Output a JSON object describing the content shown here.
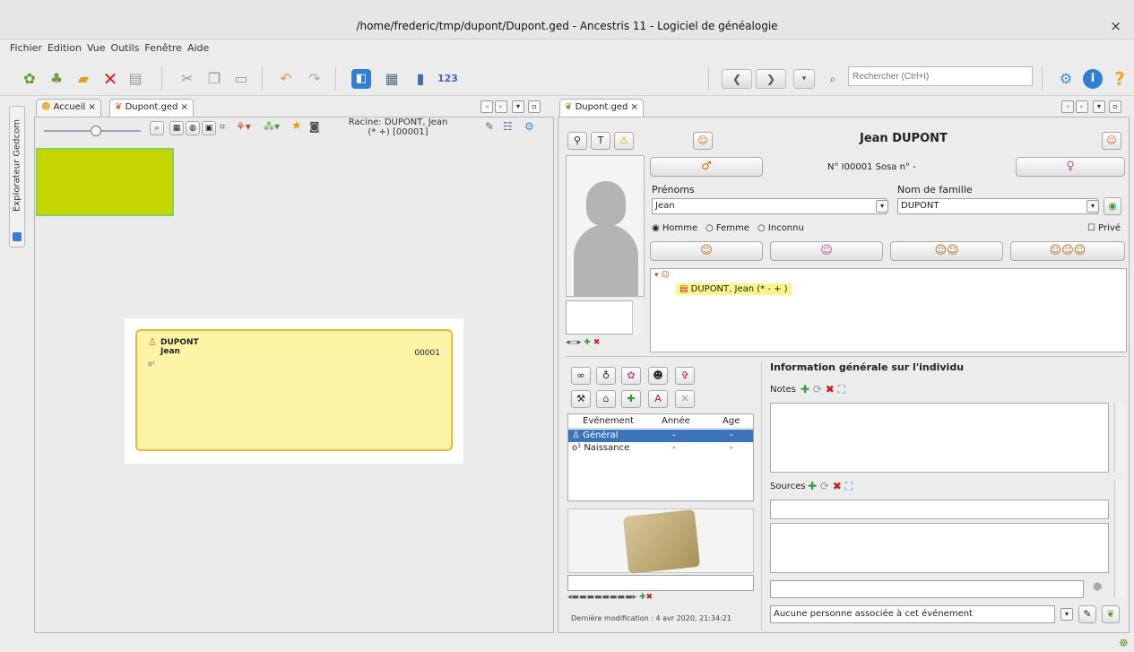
{
  "window": {
    "title": "/home/frederic/tmp/dupont/Dupont.ged - Ancestris 11 - Logiciel de généalogie",
    "close_glyph": "×"
  },
  "menu": [
    "Fichier",
    "Edition",
    "Vue",
    "Outils",
    "Fenêtre",
    "Aide"
  ],
  "search": {
    "placeholder": "Rechercher (Ctrl+I)"
  },
  "side_tab": {
    "label": "Explorateur Gedcom"
  },
  "left_panel": {
    "tabs": [
      "Accueil",
      "Dupont.ged"
    ],
    "root_label": "Racine: DUPONT, Jean",
    "root_sub": "(* +) [00001]",
    "card": {
      "surname": "DUPONT",
      "given": "Jean",
      "id": "00001",
      "birth_symbol": "o¹"
    }
  },
  "right_panel": {
    "tab": "Dupont.ged",
    "person_name": "Jean DUPONT",
    "id_line": "N° I00001   Sosa n° -",
    "prenoms_label": "Prénoms",
    "prenoms_value": "Jean",
    "nom_label": "Nom de famille",
    "nom_value": "DUPONT",
    "sex_options": [
      "Homme",
      "Femme",
      "Inconnu"
    ],
    "sex_selected": "Homme",
    "prive_label": "Privé",
    "tree_item": "DUPONT, Jean (* - + )",
    "events_header": [
      "Evénement",
      "Année",
      "Age"
    ],
    "events": [
      {
        "name": "Général",
        "year": "-",
        "age": "-"
      },
      {
        "name": "Naissance",
        "year": "-",
        "age": "-"
      }
    ],
    "info_title": "Information générale sur l'individu",
    "notes_label": "Notes",
    "sources_label": "Sources",
    "assoc_value": "Aucune personne associée à cet événement",
    "last_mod": "Dernière modification : 4 avr 2020, 21:34:21"
  }
}
